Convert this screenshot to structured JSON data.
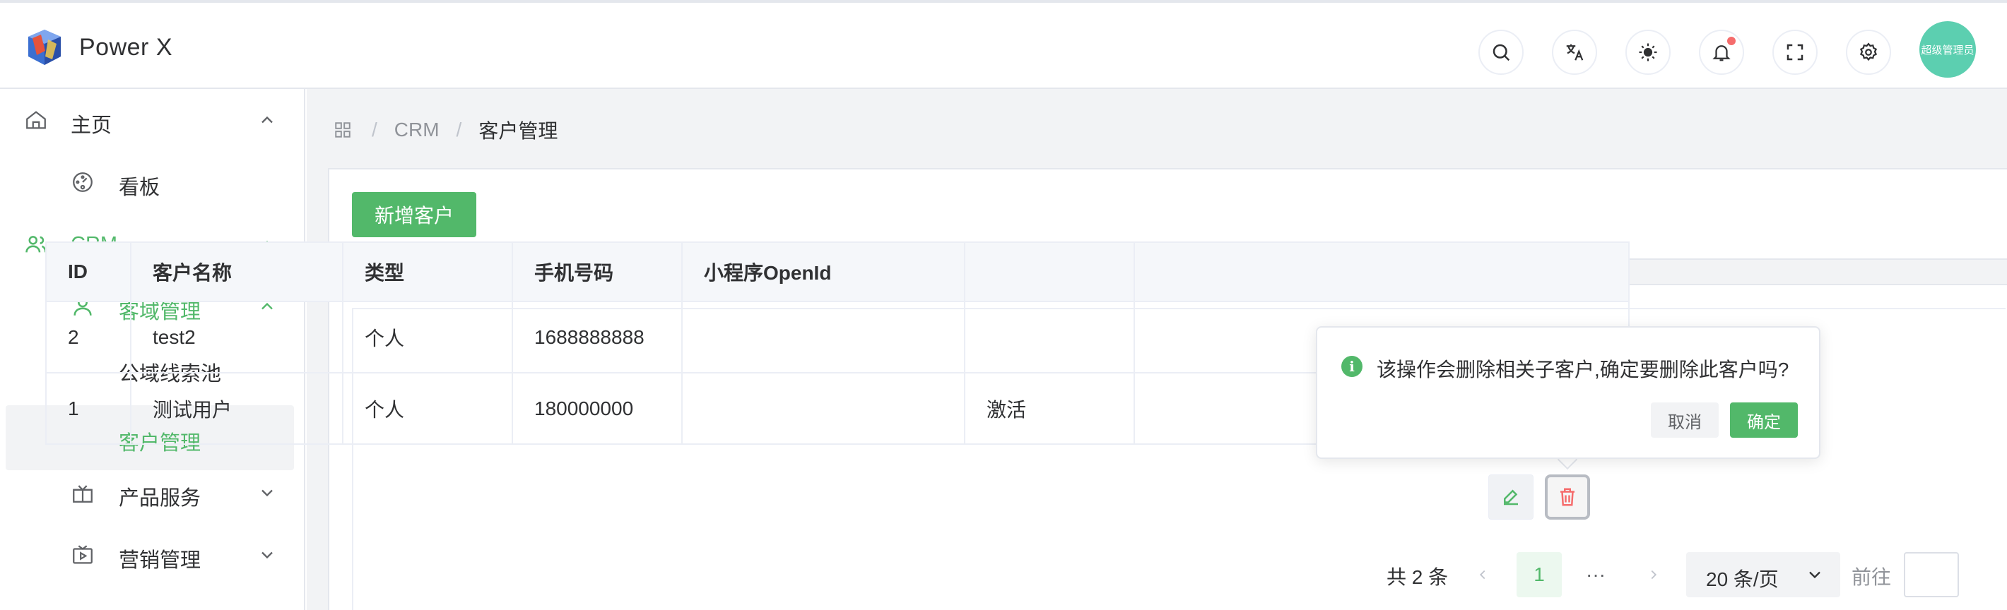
{
  "app": {
    "title": "Power X"
  },
  "header": {
    "icons": [
      "search-icon",
      "translate-icon",
      "theme-icon",
      "bell-icon",
      "fullscreen-icon",
      "gear-icon"
    ],
    "avatar_text": "超级管理员",
    "accent": "#52b86a",
    "badge_color": "#f56c6c"
  },
  "sidebar": {
    "items": [
      {
        "label": "主页",
        "icon": "home-icon",
        "arrow": "chevron-up-icon"
      },
      {
        "label": "看板",
        "icon": "dashboard-icon"
      },
      {
        "label": "CRM",
        "icon": "users-icon",
        "arrow": "chevron-up-icon"
      },
      {
        "label": "客域管理",
        "icon": "user-icon",
        "arrow": "chevron-up-icon"
      },
      {
        "label": "公域线索池"
      },
      {
        "label": "客户管理"
      },
      {
        "label": "产品服务",
        "icon": "gift-icon",
        "arrow": "chevron-down-icon"
      },
      {
        "label": "营销管理",
        "icon": "tv-icon",
        "arrow": "chevron-down-icon"
      }
    ]
  },
  "breadcrumb": {
    "items": [
      "CRM",
      "客户管理"
    ],
    "separator": "/"
  },
  "toolbar": {
    "add_label": "新增客户"
  },
  "table": {
    "headers": [
      "ID",
      "客户名称",
      "类型",
      "手机号码",
      "小程序OpenId",
      ""
    ],
    "rows": [
      [
        "2",
        "test2",
        "个人",
        "1688888888",
        "",
        ""
      ],
      [
        "1",
        "测试用户",
        "个人",
        "180000000",
        "",
        "激活"
      ]
    ]
  },
  "popconfirm": {
    "message": "该操作会删除相关子客户,确定要删除此客户吗?",
    "cancel_label": "取消",
    "confirm_label": "确定"
  },
  "pagination": {
    "total_text": "共 2 条",
    "current_page": "1",
    "more": "···",
    "page_size": "20 条/页",
    "goto_label": "前往"
  }
}
